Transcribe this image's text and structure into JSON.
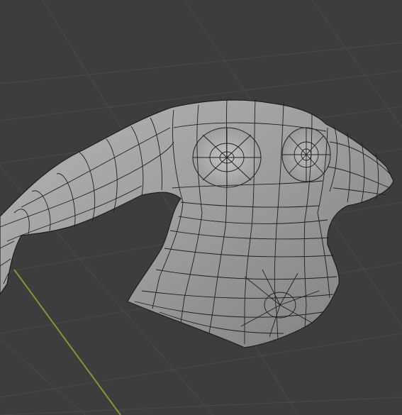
{
  "viewport": {
    "background_color": "#3d3d3d",
    "grid_color": "#4a4a4a",
    "y_axis_color": "#7a9a37"
  },
  "mesh": {
    "object_type": "torso-with-arms-wireframe-mesh",
    "fill_color": "#9c9c9c",
    "edge_color": "#1f1f1f"
  }
}
